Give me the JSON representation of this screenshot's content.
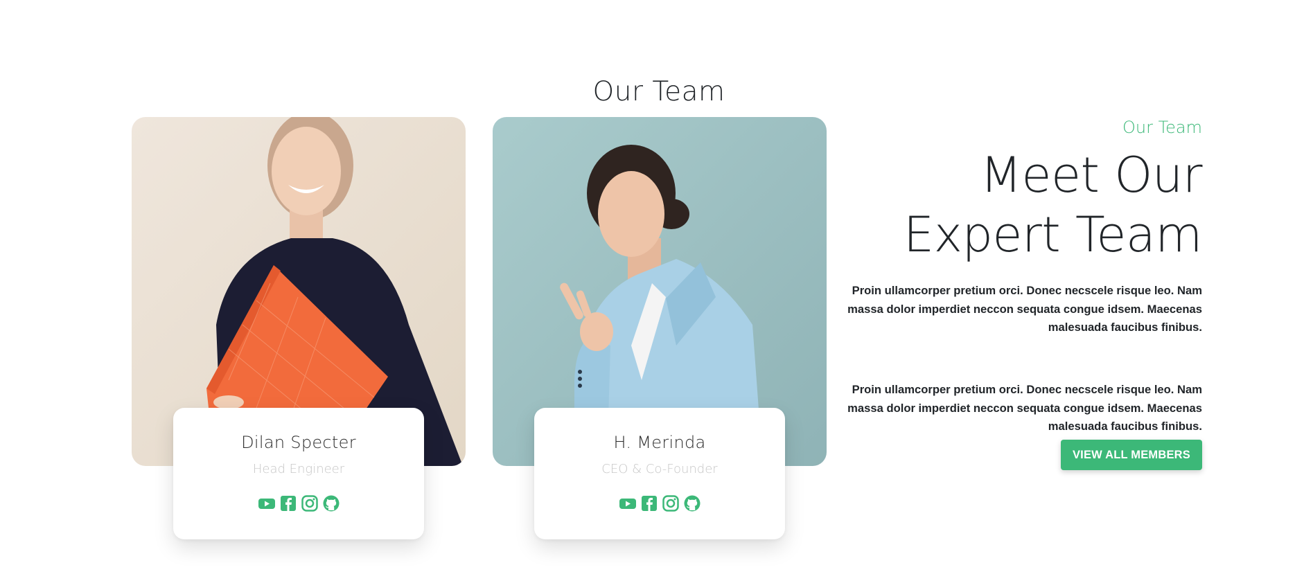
{
  "section_title": "Our Team",
  "accent_color": "#3cb878",
  "members": [
    {
      "name": "Dilan Specter",
      "role": "Head Engineer",
      "photo": "woman-smiling-holding-orange-folder",
      "socials": [
        "youtube-icon",
        "facebook-icon",
        "instagram-icon",
        "github-icon"
      ]
    },
    {
      "name": "H. Merinda",
      "role": "CEO & Co-Founder",
      "photo": "woman-in-blue-blazer-pointing",
      "socials": [
        "youtube-icon",
        "facebook-icon",
        "instagram-icon",
        "github-icon"
      ]
    }
  ],
  "intro": {
    "eyebrow": "Our Team",
    "headline": "Meet Our Expert Team",
    "paragraphs": [
      "Proin ullamcorper pretium orci. Donec necscele risque leo. Nam massa dolor imperdiet neccon sequata congue idsem. Maecenas malesuada faucibus finibus.",
      "Proin ullamcorper pretium orci. Donec necscele risque leo. Nam massa dolor imperdiet neccon sequata congue idsem. Maecenas malesuada faucibus finibus."
    ],
    "cta_label": "VIEW ALL MEMBERS"
  }
}
